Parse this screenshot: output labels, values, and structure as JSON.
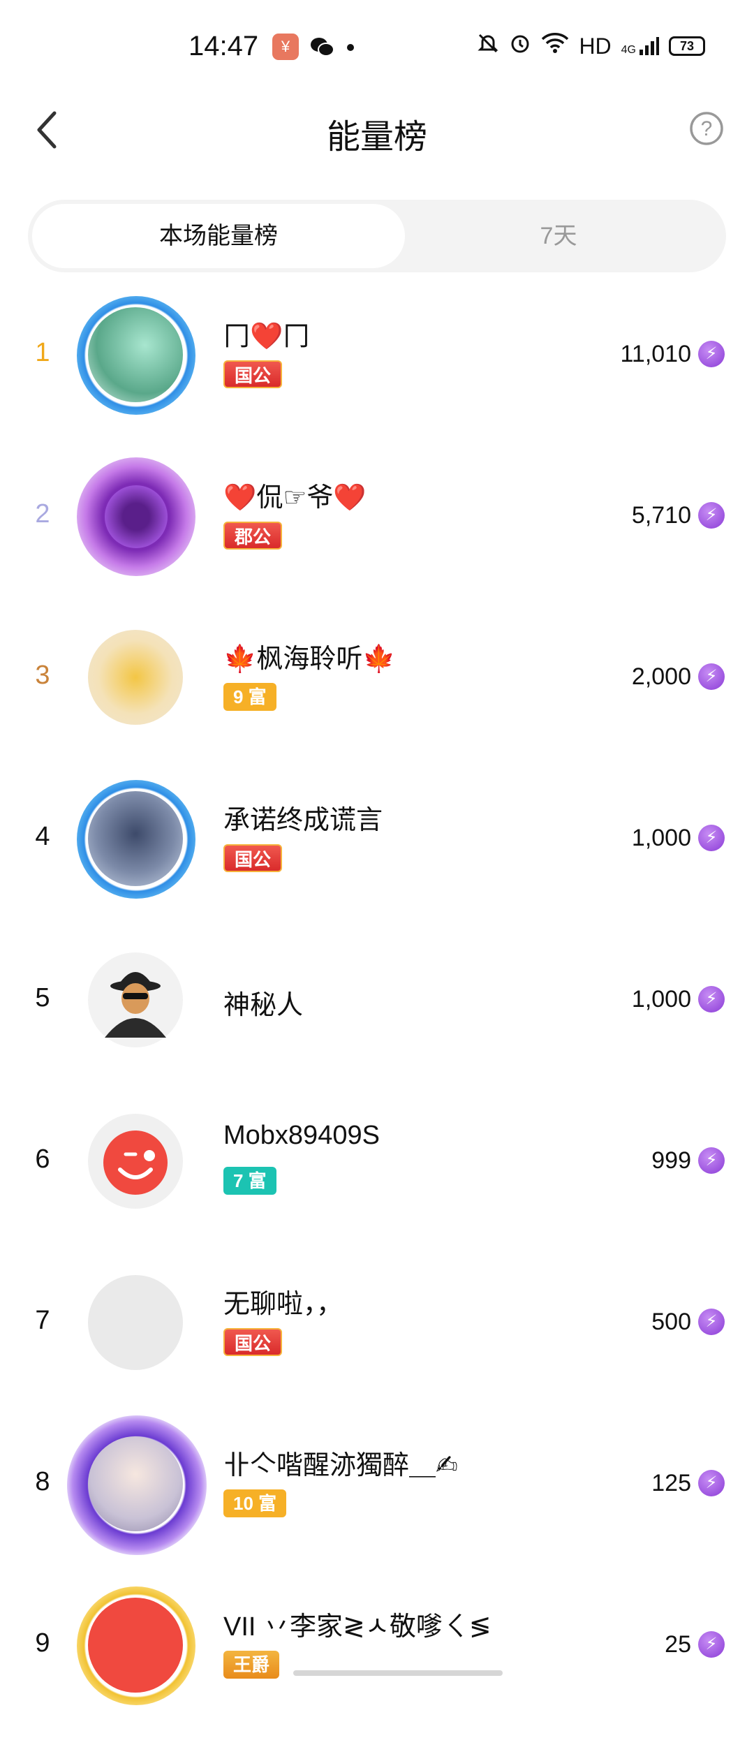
{
  "status_bar": {
    "time": "14:47",
    "network": "HD",
    "signal": "4G",
    "battery": "73"
  },
  "header": {
    "title": "能量榜"
  },
  "tabs": [
    {
      "label": "本场能量榜",
      "active": true
    },
    {
      "label": "7天",
      "active": false
    }
  ],
  "rankings": [
    {
      "rank": "1",
      "name": "冂❤️冂",
      "badge": "国公",
      "score": "11,010"
    },
    {
      "rank": "2",
      "name": "❤️侃☞爷❤️",
      "badge": "郡公",
      "score": "5,710"
    },
    {
      "rank": "3",
      "name": "🍁枫海聆听🍁",
      "badge": "9 富",
      "score": "2,000"
    },
    {
      "rank": "4",
      "name": "承诺终成谎言",
      "badge": "国公",
      "score": "1,000"
    },
    {
      "rank": "5",
      "name": "神秘人",
      "badge": "",
      "score": "1,000"
    },
    {
      "rank": "6",
      "name": "Mobx89409S",
      "badge": "7 富",
      "score": "999"
    },
    {
      "rank": "7",
      "name": "无聊啦，，",
      "badge": "国公",
      "score": "500"
    },
    {
      "rank": "8",
      "name": "卝亽喈醒洂獨醉＿✍",
      "badge": "10 富",
      "score": "125"
    },
    {
      "rank": "9",
      "name": "VII 丷李家≷ㅅ敬嗲ㄑ≶",
      "badge": "王爵",
      "score": "25"
    }
  ],
  "colors": {
    "rank1": "#f0a81a",
    "rank2": "#a9a9e0",
    "rank3": "#c9833a",
    "energy": "#8a3bd6"
  },
  "icons": {
    "back": "chevron-left-icon",
    "help": "question-circle-icon",
    "energy": "lightning-icon"
  }
}
